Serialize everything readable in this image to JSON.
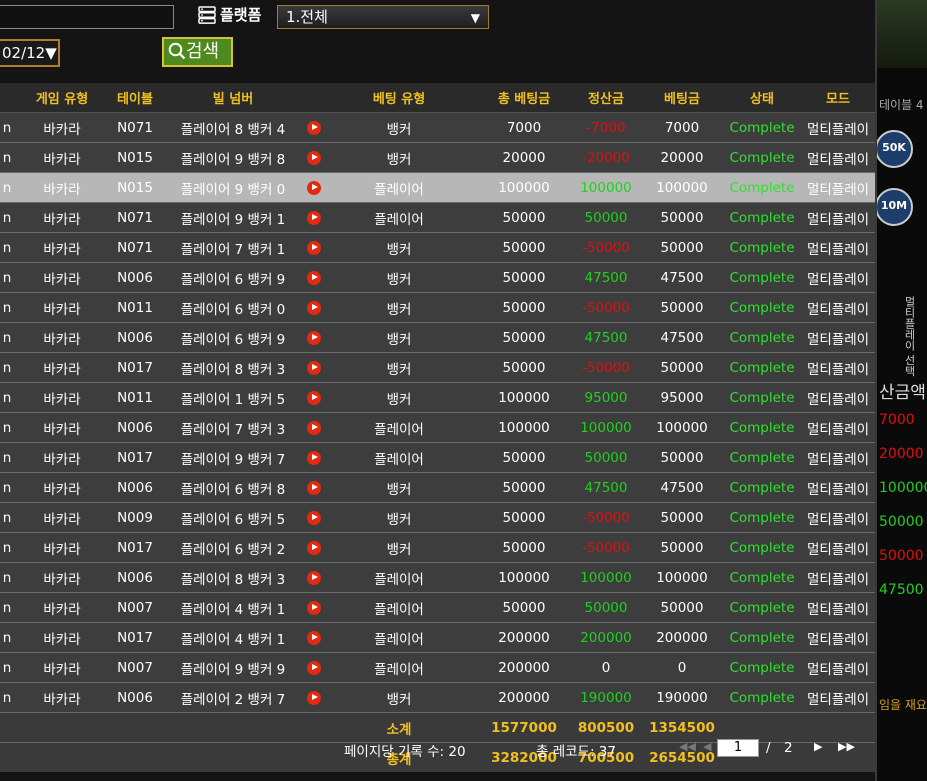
{
  "filter": {
    "platform_label": "플랫폼",
    "platform_value": "1.전체",
    "date_value": "02/12▼",
    "search_label": "검색"
  },
  "table": {
    "headers": [
      "게임 유형",
      "테이블",
      "빌 넘버",
      "",
      "베팅 유형",
      "총 베팅금",
      "정산금",
      "베팅금",
      "상태",
      "모드"
    ],
    "rows": [
      [
        "바카라",
        "N071",
        "플레이어 8 뱅커 4",
        "뱅커",
        "7000",
        "-7000",
        "7000",
        "Complete",
        "멀티플레이",
        "neg"
      ],
      [
        "바카라",
        "N015",
        "플레이어 9 뱅커 8",
        "뱅커",
        "20000",
        "-20000",
        "20000",
        "Complete",
        "멀티플레이",
        "neg"
      ],
      [
        "바카라",
        "N015",
        "플레이어 9 뱅커 0",
        "플레이어",
        "100000",
        "100000",
        "100000",
        "Complete",
        "멀티플레이",
        "pos"
      ],
      [
        "바카라",
        "N071",
        "플레이어 9 뱅커 1",
        "플레이어",
        "50000",
        "50000",
        "50000",
        "Complete",
        "멀티플레이",
        "pos"
      ],
      [
        "바카라",
        "N071",
        "플레이어 7 뱅커 1",
        "뱅커",
        "50000",
        "-50000",
        "50000",
        "Complete",
        "멀티플레이",
        "neg"
      ],
      [
        "바카라",
        "N006",
        "플레이어 6 뱅커 9",
        "뱅커",
        "50000",
        "47500",
        "47500",
        "Complete",
        "멀티플레이",
        "pos"
      ],
      [
        "바카라",
        "N011",
        "플레이어 6 뱅커 0",
        "뱅커",
        "50000",
        "-50000",
        "50000",
        "Complete",
        "멀티플레이",
        "neg"
      ],
      [
        "바카라",
        "N006",
        "플레이어 6 뱅커 9",
        "뱅커",
        "50000",
        "47500",
        "47500",
        "Complete",
        "멀티플레이",
        "pos"
      ],
      [
        "바카라",
        "N017",
        "플레이어 8 뱅커 3",
        "뱅커",
        "50000",
        "-50000",
        "50000",
        "Complete",
        "멀티플레이",
        "neg"
      ],
      [
        "바카라",
        "N011",
        "플레이어 1 뱅커 5",
        "뱅커",
        "100000",
        "95000",
        "95000",
        "Complete",
        "멀티플레이",
        "pos"
      ],
      [
        "바카라",
        "N006",
        "플레이어 7 뱅커 3",
        "플레이어",
        "100000",
        "100000",
        "100000",
        "Complete",
        "멀티플레이",
        "pos"
      ],
      [
        "바카라",
        "N017",
        "플레이어 9 뱅커 7",
        "플레이어",
        "50000",
        "50000",
        "50000",
        "Complete",
        "멀티플레이",
        "pos"
      ],
      [
        "바카라",
        "N006",
        "플레이어 6 뱅커 8",
        "뱅커",
        "50000",
        "47500",
        "47500",
        "Complete",
        "멀티플레이",
        "pos"
      ],
      [
        "바카라",
        "N009",
        "플레이어 6 뱅커 5",
        "뱅커",
        "50000",
        "-50000",
        "50000",
        "Complete",
        "멀티플레이",
        "neg"
      ],
      [
        "바카라",
        "N017",
        "플레이어 6 뱅커 2",
        "뱅커",
        "50000",
        "-50000",
        "50000",
        "Complete",
        "멀티플레이",
        "neg"
      ],
      [
        "바카라",
        "N006",
        "플레이어 8 뱅커 3",
        "플레이어",
        "100000",
        "100000",
        "100000",
        "Complete",
        "멀티플레이",
        "pos"
      ],
      [
        "바카라",
        "N007",
        "플레이어 4 뱅커 1",
        "플레이어",
        "50000",
        "50000",
        "50000",
        "Complete",
        "멀티플레이",
        "pos"
      ],
      [
        "바카라",
        "N017",
        "플레이어 4 뱅커 1",
        "플레이어",
        "200000",
        "200000",
        "200000",
        "Complete",
        "멀티플레이",
        "pos"
      ],
      [
        "바카라",
        "N007",
        "플레이어 9 뱅커 9",
        "플레이어",
        "200000",
        "0",
        "0",
        "Complete",
        "멀티플레이",
        "zero"
      ],
      [
        "바카라",
        "N006",
        "플레이어 2 뱅커 7",
        "뱅커",
        "200000",
        "190000",
        "190000",
        "Complete",
        "멀티플레이",
        "pos"
      ]
    ],
    "subtotal": {
      "label": "소계",
      "total_bet": "1577000",
      "settlement": "800500",
      "bet": "1354500"
    },
    "grandtotal": {
      "label": "총계",
      "total_bet": "3282000",
      "settlement": "700500",
      "bet": "2654500"
    }
  },
  "footer": {
    "records_per_page": "페이지당 기록 수: 20",
    "total_records": "총 레코드: 37",
    "current_page": "1",
    "page_separator": "/",
    "total_pages": "2"
  },
  "background": {
    "table_label": "테이블 4",
    "chip_50k": "50K",
    "chip_10m": "10M",
    "settle_label": "산금액",
    "side_text": "멀티플레이 선택",
    "values": [
      "7000",
      "20000",
      "100000",
      "50000",
      "50000",
      "47500"
    ],
    "promo_text": "임을 재요"
  },
  "colors": {
    "accent": "#f0c020",
    "negative": "#e01010",
    "positive": "#20d020",
    "selected_row": "#b7b7b7"
  }
}
